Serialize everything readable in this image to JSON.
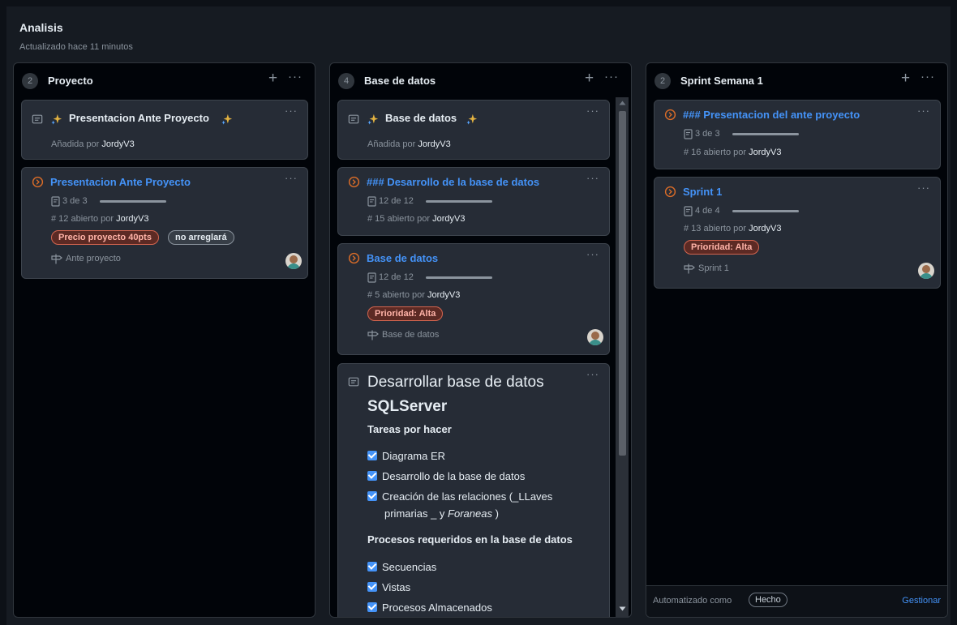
{
  "header": {
    "title": "Analisis",
    "subtitle": "Actualizado hace 11 minutos"
  },
  "columns": [
    {
      "count": "2",
      "title": "Proyecto",
      "cards": [
        {
          "title": "Presentacion Ante Proyecto",
          "meta_prefix": "Añadida por ",
          "author": "JordyV3"
        },
        {
          "title": "Presentacion Ante Proyecto",
          "tasks": "3 de 3",
          "meta_prefix": "# 12 abierto por ",
          "author": "JordyV3",
          "labels": [
            "Precio proyecto 40pts",
            "no arreglará"
          ],
          "milestone": "Ante proyecto"
        }
      ]
    },
    {
      "count": "4",
      "title": "Base de datos",
      "cards": [
        {
          "title": "Base de datos",
          "meta_prefix": "Añadida por ",
          "author": "JordyV3"
        },
        {
          "title": "### Desarrollo de la base de datos",
          "tasks": "12 de 12",
          "meta_prefix": "# 15 abierto por ",
          "author": "JordyV3"
        },
        {
          "title": "Base de datos",
          "tasks": "12 de 12",
          "meta_prefix": "# 5 abierto por ",
          "author": "JordyV3",
          "labels": [
            "Prioridad: Alta"
          ],
          "milestone": "Base de datos"
        },
        {
          "heading_line1": "Desarrollar base de datos",
          "heading_line2": "SQLServer",
          "subheading1": "Tareas por hacer",
          "tasks1": [
            "Diagrama ER",
            "Desarrollo de la base de datos"
          ],
          "task3_a": "Creación de las relaciones (_LLaves",
          "task3_b": "primarias _ y ",
          "task3_c": "Foraneas",
          "task3_d": " )",
          "subheading2": "Procesos requeridos en la base de datos",
          "tasks2": [
            "Secuencias",
            "Vistas",
            "Procesos Almacenados"
          ]
        }
      ]
    },
    {
      "count": "2",
      "title": "Sprint Semana 1",
      "cards": [
        {
          "title": "### Presentacion del ante proyecto",
          "tasks": "3 de 3",
          "meta_prefix": "# 16 abierto por ",
          "author": "JordyV3"
        },
        {
          "title": "Sprint 1",
          "tasks": "4 de 4",
          "meta_prefix": "# 13 abierto por ",
          "author": "JordyV3",
          "labels": [
            "Prioridad: Alta"
          ],
          "milestone": "Sprint 1"
        }
      ],
      "footer": {
        "automated": "Automatizado como",
        "status": "Hecho",
        "manage": "Gestionar"
      }
    }
  ],
  "symbols": {
    "plus": "+",
    "more": "···"
  },
  "colors": {
    "issue_open": "#db6d28",
    "link": "#4493f8",
    "label_red": "#d4654f",
    "sparkle": "#e3b341"
  }
}
